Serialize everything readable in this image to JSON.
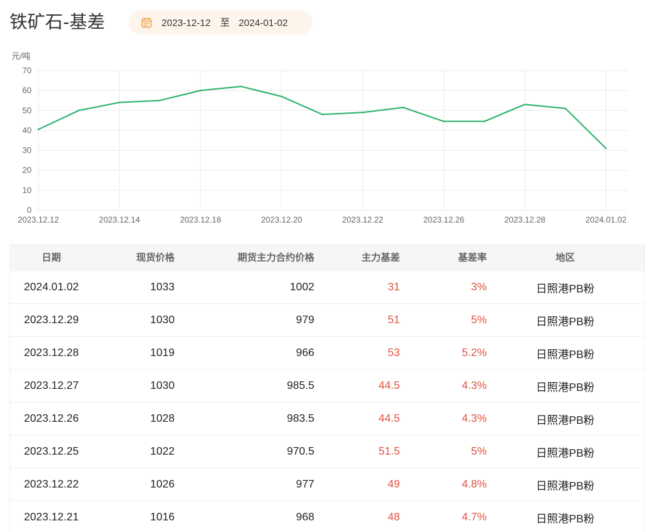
{
  "header": {
    "title": "铁矿石-基差",
    "date_start": "2023-12-12",
    "date_separator": "至",
    "date_end": "2024-01-02",
    "accent_color": "#e8a04a"
  },
  "chart_data": {
    "type": "line",
    "unit_label": "元/吨",
    "ylim": [
      0,
      70
    ],
    "y_ticks": [
      "0",
      "10",
      "20",
      "30",
      "40",
      "50",
      "60",
      "70"
    ],
    "x_tick_labels": [
      "2023.12.12",
      "2023.12.14",
      "2023.12.18",
      "2023.12.20",
      "2023.12.22",
      "2023.12.26",
      "2023.12.28",
      "2024.01.02"
    ],
    "x_tick_indices": [
      0,
      2,
      4,
      6,
      8,
      10,
      12,
      14
    ],
    "x": [
      "2023.12.12",
      "2023.12.13",
      "2023.12.14",
      "2023.12.15",
      "2023.12.18",
      "2023.12.19",
      "2023.12.20",
      "2023.12.21",
      "2023.12.22",
      "2023.12.25",
      "2023.12.26",
      "2023.12.27",
      "2023.12.28",
      "2023.12.29",
      "2024.01.02"
    ],
    "series": [
      {
        "values": [
          40.5,
          50,
          54,
          55,
          60,
          62,
          57,
          48,
          49,
          51.5,
          44.5,
          44.5,
          53,
          51,
          31
        ],
        "color": "#2eb26c"
      }
    ],
    "grid": true
  },
  "table": {
    "headers": {
      "date": "日期",
      "spot": "现货价格",
      "futures": "期货主力合约价格",
      "basis": "主力基差",
      "rate": "基差率",
      "region": "地区"
    },
    "rows": [
      {
        "date": "2024.01.02",
        "spot": "1033",
        "futures": "1002",
        "basis": "31",
        "rate": "3%",
        "region": "日照港PB粉"
      },
      {
        "date": "2023.12.29",
        "spot": "1030",
        "futures": "979",
        "basis": "51",
        "rate": "5%",
        "region": "日照港PB粉"
      },
      {
        "date": "2023.12.28",
        "spot": "1019",
        "futures": "966",
        "basis": "53",
        "rate": "5.2%",
        "region": "日照港PB粉"
      },
      {
        "date": "2023.12.27",
        "spot": "1030",
        "futures": "985.5",
        "basis": "44.5",
        "rate": "4.3%",
        "region": "日照港PB粉"
      },
      {
        "date": "2023.12.26",
        "spot": "1028",
        "futures": "983.5",
        "basis": "44.5",
        "rate": "4.3%",
        "region": "日照港PB粉"
      },
      {
        "date": "2023.12.25",
        "spot": "1022",
        "futures": "970.5",
        "basis": "51.5",
        "rate": "5%",
        "region": "日照港PB粉"
      },
      {
        "date": "2023.12.22",
        "spot": "1026",
        "futures": "977",
        "basis": "49",
        "rate": "4.8%",
        "region": "日照港PB粉"
      },
      {
        "date": "2023.12.21",
        "spot": "1016",
        "futures": "968",
        "basis": "48",
        "rate": "4.7%",
        "region": "日照港PB粉"
      }
    ],
    "highlight_color": "#e0533f"
  }
}
